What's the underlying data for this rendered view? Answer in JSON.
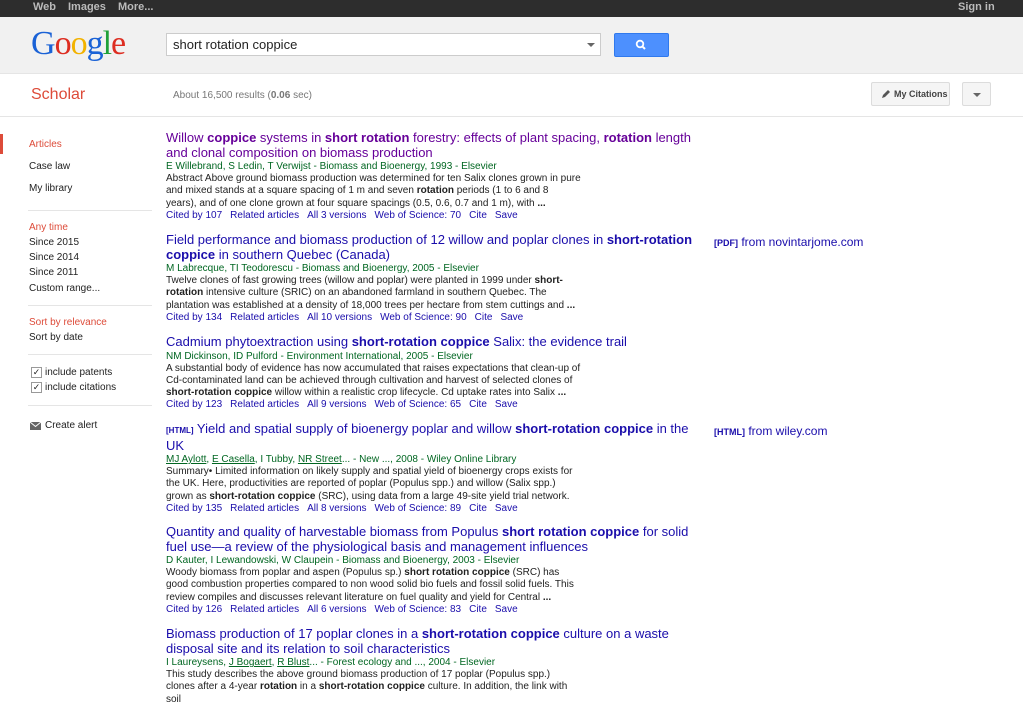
{
  "topbar": {
    "web": "Web",
    "images": "Images",
    "more": "More...",
    "signin": "Sign in"
  },
  "logo": [
    "G",
    "o",
    "o",
    "g",
    "l",
    "e"
  ],
  "search": {
    "query": "short rotation coppice"
  },
  "scholar": "Scholar",
  "stats": {
    "prefix": "About 16,500 results (",
    "time": "0.06",
    "suffix": " sec)"
  },
  "my_citations": "My Citations",
  "sidebar": {
    "articles": "Articles",
    "case_law": "Case law",
    "my_library": "My library",
    "any_time": "Any time",
    "since2015": "Since 2015",
    "since2014": "Since 2014",
    "since2011": "Since 2011",
    "custom": "Custom range...",
    "sort_rel": "Sort by relevance",
    "sort_date": "Sort by date",
    "patents": "include patents",
    "citations": "include citations",
    "alert": "Create alert"
  },
  "results": [
    {
      "title_html": "Willow <b>coppice</b> systems in <b>short rotation</b> forestry: effects of plant spacing, <b>rotation</b> length and clonal composition on biomass production",
      "authors_html": "E Willebrand, S Ledin, T Verwijst - Biomass and Bioenergy, 1993 - Elsevier",
      "snippet_html": "Abstract Above ground biomass production was determined for ten Salix clones grown in pure and mixed stands at a square spacing of 1 m and seven <b>rotation</b> periods (1 to 6 and 8 years), and of one clone grown at four square spacings (0.5, 0.6, 0.7 and 1 m), with <b>...</b>",
      "links": [
        "Cited by 107",
        "Related articles",
        "All 3 versions",
        "Web of Science: 70",
        "Cite",
        "Save"
      ],
      "visited": true
    },
    {
      "title_html": "Field performance and biomass production of 12 willow and poplar clones in <b>short-rotation coppice</b> in southern Quebec (Canada)",
      "authors_html": "M Labrecque, TI Teodorescu - Biomass and Bioenergy, 2005 - Elsevier",
      "snippet_html": "Twelve clones of fast growing trees (willow and poplar) were planted in 1999 under <b>short-rotation</b> intensive culture (SRIC) on an abandoned farmland in southern Quebec. The plantation was established at a density of 18,000 trees per hectare from stem cuttings and <b>...</b>",
      "links": [
        "Cited by 134",
        "Related articles",
        "All 10 versions",
        "Web of Science: 90",
        "Cite",
        "Save"
      ],
      "side": {
        "tag": "[PDF]",
        "text": " from novintarjome.com"
      }
    },
    {
      "title_html": "Cadmium phytoextraction using <b>short-rotation coppice</b> Salix: the evidence trail",
      "authors_html": "NM Dickinson, ID Pulford - Environment International, 2005 - Elsevier",
      "snippet_html": "A substantial body of evidence has now accumulated that raises expectations that clean-up of Cd-contaminated land can be achieved through cultivation and harvest of selected clones of <b>short-rotation coppice</b> willow within a realistic crop lifecycle. Cd uptake rates into Salix <b>...</b>",
      "links": [
        "Cited by 123",
        "Related articles",
        "All 9 versions",
        "Web of Science: 65",
        "Cite",
        "Save"
      ]
    },
    {
      "title_html": "<span class=\"htag\">[HTML]</span> Yield and spatial supply of bioenergy poplar and willow <b>short-rotation coppice</b> in the UK",
      "authors_html": "<u>MJ Aylott</u>, <u>E Casella</u>, I Tubby, <u>NR Street</u>... - New ..., 2008 - Wiley Online Library",
      "snippet_html": "Summary• Limited information on likely supply and spatial yield of bioenergy crops exists for the UK. Here, productivities are reported of poplar (Populus spp.) and willow (Salix spp.) grown as <b>short-rotation coppice</b> (SRC), using data from a large 49-site yield trial network.",
      "links": [
        "Cited by 135",
        "Related articles",
        "All 8 versions",
        "Web of Science: 89",
        "Cite",
        "Save"
      ],
      "side": {
        "tag": "[HTML]",
        "text": " from wiley.com"
      }
    },
    {
      "title_html": "Quantity and quality of harvestable biomass from Populus <b>short rotation coppice</b> for solid fuel use—a review of the physiological basis and management influences",
      "authors_html": "D Kauter, I Lewandowski, W Claupein - Biomass and Bioenergy, 2003 - Elsevier",
      "snippet_html": "Woody biomass from poplar and aspen (Populus sp.) <b>short rotation coppice</b> (SRC) has good combustion properties compared to non wood solid bio fuels and fossil solid fuels. This review compiles and discusses relevant literature on fuel quality and yield for Central <b>...</b>",
      "links": [
        "Cited by 126",
        "Related articles",
        "All 6 versions",
        "Web of Science: 83",
        "Cite",
        "Save"
      ]
    },
    {
      "title_html": "Biomass production of 17 poplar clones in a <b>short-rotation coppice</b> culture on a waste disposal site and its relation to soil characteristics",
      "authors_html": "I Laureysens, <u>J Bogaert</u>, <u>R Blust</u>... - Forest ecology and ..., 2004 - Elsevier",
      "snippet_html": "This study describes the above ground biomass production of 17 poplar (Populus spp.) clones after a 4-year <b>rotation</b> in a <b>short-rotation coppice</b> culture. In addition, the link with soil",
      "links": []
    }
  ]
}
